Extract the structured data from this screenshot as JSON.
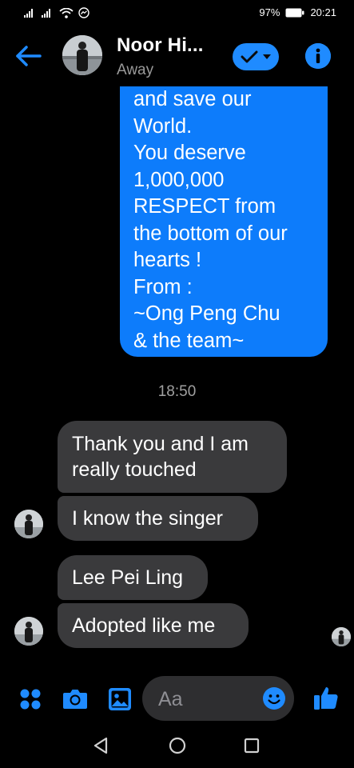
{
  "status_bar": {
    "battery": "97%",
    "time": "20:21"
  },
  "header": {
    "contact_name": "Noor Hi...",
    "presence": "Away",
    "accent": "#1f8bff"
  },
  "messages": {
    "outgoing": [
      "and save our",
      "World.",
      "You deserve",
      "1,000,000",
      "RESPECT from",
      "the bottom of our",
      "hearts !",
      "From :",
      "~Ong Peng Chu",
      "& the team~"
    ],
    "timestamp": "18:50",
    "incoming": [
      {
        "lines": [
          "Thank you and I am",
          "really touched"
        ]
      },
      {
        "lines": [
          "I know the singer"
        ]
      },
      {
        "lines": [
          "Lee Pei Ling"
        ]
      },
      {
        "lines": [
          "Adopted like me"
        ]
      }
    ]
  },
  "composer": {
    "placeholder": "Aa",
    "icons": [
      "apps-icon",
      "camera-icon",
      "gallery-icon",
      "emoji-icon",
      "like-icon"
    ]
  },
  "colors": {
    "outgoing_bubble": "#0d7cfb",
    "incoming_bubble": "#3a3a3c",
    "background": "#000000"
  }
}
